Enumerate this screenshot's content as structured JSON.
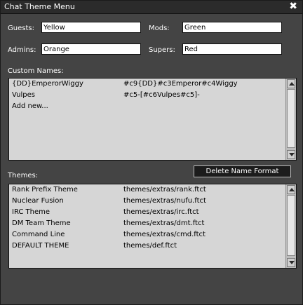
{
  "window": {
    "title": "Chat Theme Menu",
    "close_glyph": "✖"
  },
  "fields": {
    "guests": {
      "label": "Guests:",
      "value": "Yellow"
    },
    "mods": {
      "label": "Mods:",
      "value": "Green"
    },
    "admins": {
      "label": "Admins:",
      "value": "Orange"
    },
    "supers": {
      "label": "Supers:",
      "value": "Red"
    }
  },
  "custom_names": {
    "label": "Custom Names:",
    "rows": [
      {
        "name": "{DD}EmperorWiggy",
        "format": "#c9{DD}#c3Emperor#c4Wiggy"
      },
      {
        "name": "Vulpes",
        "format": "#c5-[#c6Vulpes#c5]-"
      },
      {
        "name": "Add new...",
        "format": ""
      }
    ],
    "delete_button": "Delete Name Format"
  },
  "themes": {
    "label": "Themes:",
    "rows": [
      {
        "name": "Rank Prefix Theme",
        "path": "themes/extras/rank.ftct"
      },
      {
        "name": "Nuclear Fusion",
        "path": "themes/extras/nufu.ftct"
      },
      {
        "name": "IRC Theme",
        "path": "themes/extras/irc.ftct"
      },
      {
        "name": "DM Team Theme",
        "path": "themes/extras/dmt.ftct"
      },
      {
        "name": "Command Line",
        "path": "themes/extras/cmd.ftct"
      },
      {
        "name": "DEFAULT THEME",
        "path": "themes/def.ftct"
      }
    ]
  },
  "icons": {
    "close": "close-icon",
    "scroll_up": "triangle-up-icon",
    "scroll_down": "triangle-down-icon"
  },
  "colors": {
    "window_bg": "#444444",
    "titlebar_bg": "#2b2b2b",
    "list_bg": "#d6d6d6",
    "button_bg": "#1c1c1c"
  }
}
